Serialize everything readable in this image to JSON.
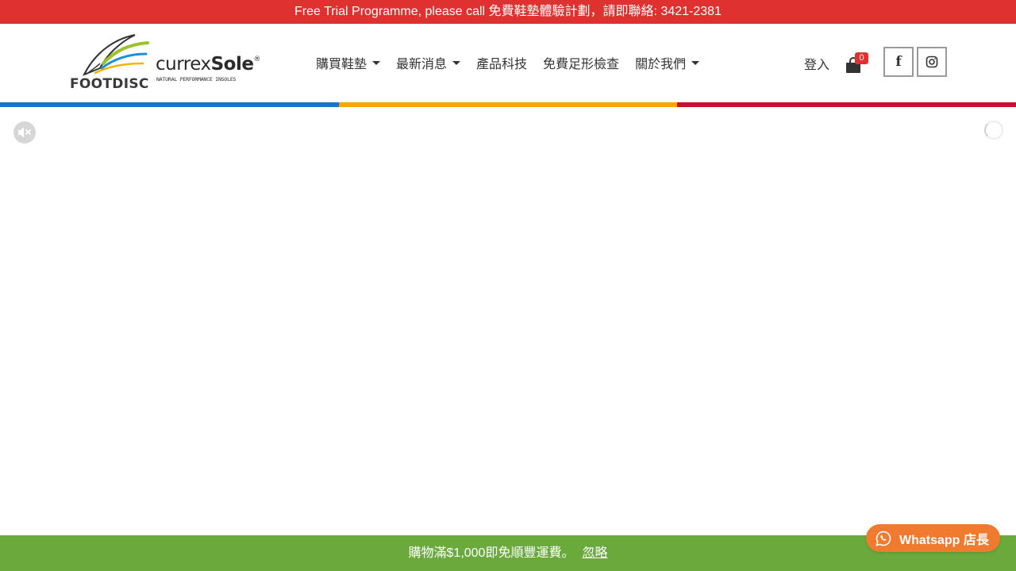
{
  "topbar": {
    "text": "Free Trial Programme, please call 免費鞋墊體驗計劃，請即聯絡: 3421-2381"
  },
  "brand": {
    "footdisc": "FOOTDISC",
    "currex_light": "currex",
    "currex_bold": "Sole",
    "registered": "®",
    "tagline": "NATURAL PERFORMANCE INSOLES"
  },
  "nav": {
    "items": [
      {
        "label": "購買鞋墊",
        "has_dropdown": true
      },
      {
        "label": "最新消息",
        "has_dropdown": true
      },
      {
        "label": "產品科技",
        "has_dropdown": false
      },
      {
        "label": "免費足形檢查",
        "has_dropdown": false
      },
      {
        "label": "關於我們",
        "has_dropdown": true
      }
    ]
  },
  "account": {
    "login_label": "登入",
    "cart_count": "0"
  },
  "social": {
    "facebook_icon": "facebook-icon",
    "instagram_icon": "instagram-icon"
  },
  "colors": {
    "topbar": "#e03131",
    "stripe_blue": "#1a73c9",
    "stripe_yellow": "#f5a700",
    "stripe_red": "#c8102e",
    "promo_green": "#6aaa3d",
    "whatsapp_orange": "#f07a2e"
  },
  "promo": {
    "text": "購物滿$1,000即免順豐運費。",
    "dismiss_label": "忽略"
  },
  "whatsapp": {
    "label": "Whatsapp 店長"
  }
}
